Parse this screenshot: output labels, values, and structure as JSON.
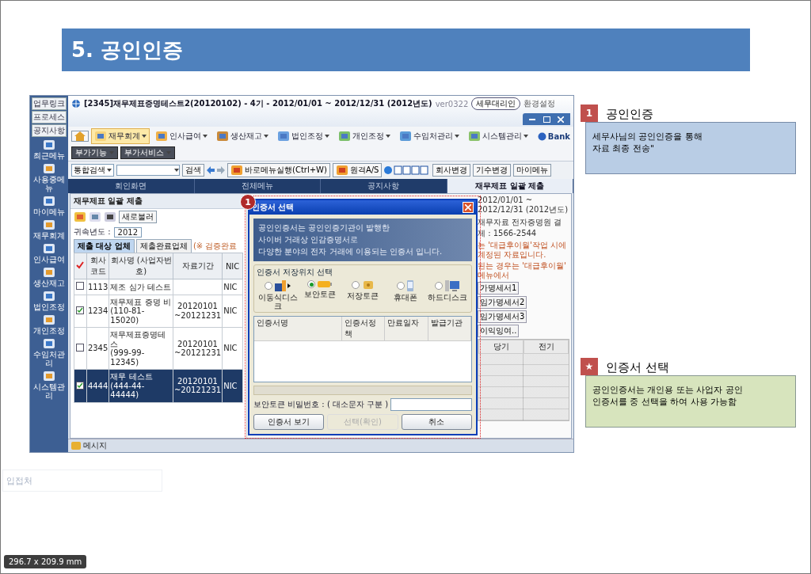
{
  "header": {
    "title": "5. 공인인증"
  },
  "app": {
    "title": "[2345]재무제표증명테스트2(20120102) - 4기 - 2012/01/01 ~ 2012/12/31 (2012년도)",
    "version": "ver0322",
    "title_buttons": [
      "세무대리인",
      "환경설정"
    ],
    "side_links": [
      "업무링크",
      "프로세스",
      "공지사항"
    ],
    "side_menu": [
      "최근메뉴",
      "사용중메뉴",
      "마이메뉴",
      "재무회계",
      "인사급여",
      "생산재고",
      "법인조정",
      "개인조정",
      "수임처관리",
      "시스템관리"
    ],
    "menus": [
      {
        "label": "재무회계",
        "selected": true
      },
      {
        "label": "인사급여",
        "selected": false
      },
      {
        "label": "생산재고",
        "selected": false
      },
      {
        "label": "법인조정",
        "selected": false
      },
      {
        "label": "개인조정",
        "selected": false
      },
      {
        "label": "수임처관리",
        "selected": false
      },
      {
        "label": "시스템관리",
        "selected": false
      }
    ],
    "bank_logo": "Bank",
    "extra_menus": [
      "부가기능",
      "부가서비스"
    ],
    "search": {
      "value": "통합검색",
      "button": "검색"
    },
    "quick_buttons": [
      "바로메뉴실행(Ctrl+W)",
      "원격A/S"
    ],
    "right_buttons": [
      "회사변경",
      "기수변경",
      "마이메뉴"
    ],
    "tabs": [
      {
        "label": "회인화면",
        "selected": false
      },
      {
        "label": "전체메뉴",
        "selected": false
      },
      {
        "label": "공지사항",
        "selected": false
      },
      {
        "label": "재무제표 일괄 제출",
        "selected": true
      }
    ],
    "panel_title": "재무제표 일괄 제출",
    "reload_button": "새로불러",
    "period": "2012/01/01 ~ 2012/12/31 (2012년도)",
    "contact": "재무자료 전자증명원 결제 : 1566-2544",
    "year": {
      "label": "귀속년도 :",
      "value": "2012"
    },
    "sub_tabs": [
      {
        "label": "제출 대상 업체",
        "selected": true
      },
      {
        "label": "제출완료업체",
        "selected": false
      }
    ],
    "sub_note": "(※ 검증완료",
    "notices": [
      "는 '대급후이월'작업 시에 계정된 자료입니다.",
      "된는 경우는 '대급후이월' 메뉴에서"
    ],
    "table": {
      "columns": [
        "회사 코드",
        "회사명 (사업자번호)",
        "자료기간",
        "NIC"
      ],
      "rows": [
        {
          "checked": false,
          "selected": false,
          "code": "1113",
          "name": "제조 심가 테스트",
          "bizno": "",
          "period": "",
          "column_5": "NIC"
        },
        {
          "checked": true,
          "selected": false,
          "code": "1234",
          "name": "재무제표 증명 비",
          "bizno": "(110-81-15020)",
          "period": "20120101 ~20121231",
          "column_5": "NIC"
        },
        {
          "checked": false,
          "selected": false,
          "code": "2345",
          "name": "재무제표증명테스",
          "bizno": "(999-99-12345)",
          "period": "20120101 ~20121231",
          "column_5": "NIC"
        },
        {
          "checked": true,
          "selected": true,
          "code": "4444",
          "name": "재무 테스트",
          "bizno": "(444-44-44444)",
          "period": "20120101 ~20121231",
          "column_5": "NIC"
        }
      ]
    },
    "grid_tabs": [
      "가명세서1",
      "임가명세서2",
      "임가명세서3",
      "이익잉여.."
    ],
    "grid_columns": [
      "당기",
      "전기"
    ],
    "status": "메시지"
  },
  "dialog": {
    "marker": "1",
    "title": "인증서 선택",
    "banner": [
      "공인인증서는 공인인증기관이 발행한",
      "사이버 거래상 인감증명서로",
      "다양한 분야의 전자 거래에 이용되는 인증서 입니다."
    ],
    "location_label": "인증서 저장위치 선택",
    "locations": [
      {
        "label": "이동식디스크",
        "kind": "usb",
        "selected": false
      },
      {
        "label": "보안토큰",
        "kind": "token",
        "selected": true
      },
      {
        "label": "저장토큰",
        "kind": "card",
        "selected": false
      },
      {
        "label": "휴대폰",
        "kind": "phone",
        "selected": false
      },
      {
        "label": "하드디스크",
        "kind": "disk",
        "selected": false
      }
    ],
    "list_columns": [
      "인증서명",
      "인증서정책",
      "만료일자",
      "발급기관"
    ],
    "password_label": "보안토큰 비밀번호 : ( 대소문자 구분 )",
    "buttons": [
      {
        "label": "인증서 보기",
        "disabled": false
      },
      {
        "label": "선택(확인)",
        "disabled": true
      },
      {
        "label": "취소",
        "disabled": false
      }
    ]
  },
  "callouts": [
    {
      "marker": "1",
      "title": "공인인증",
      "text": "세무사님의 공인인증을 통해\n자료 최종 전송\"",
      "color": "#b9cde5"
    },
    {
      "marker": "★",
      "title": "인증서 선택",
      "text": "공인인증서는 개인용 또는 사업자 공인\n인증서를 중 선택을 하여 사용 가능함",
      "color": "#d7e4bd"
    }
  ],
  "stray_label": "입접처",
  "page_size": "296.7 x 209.9 mm"
}
